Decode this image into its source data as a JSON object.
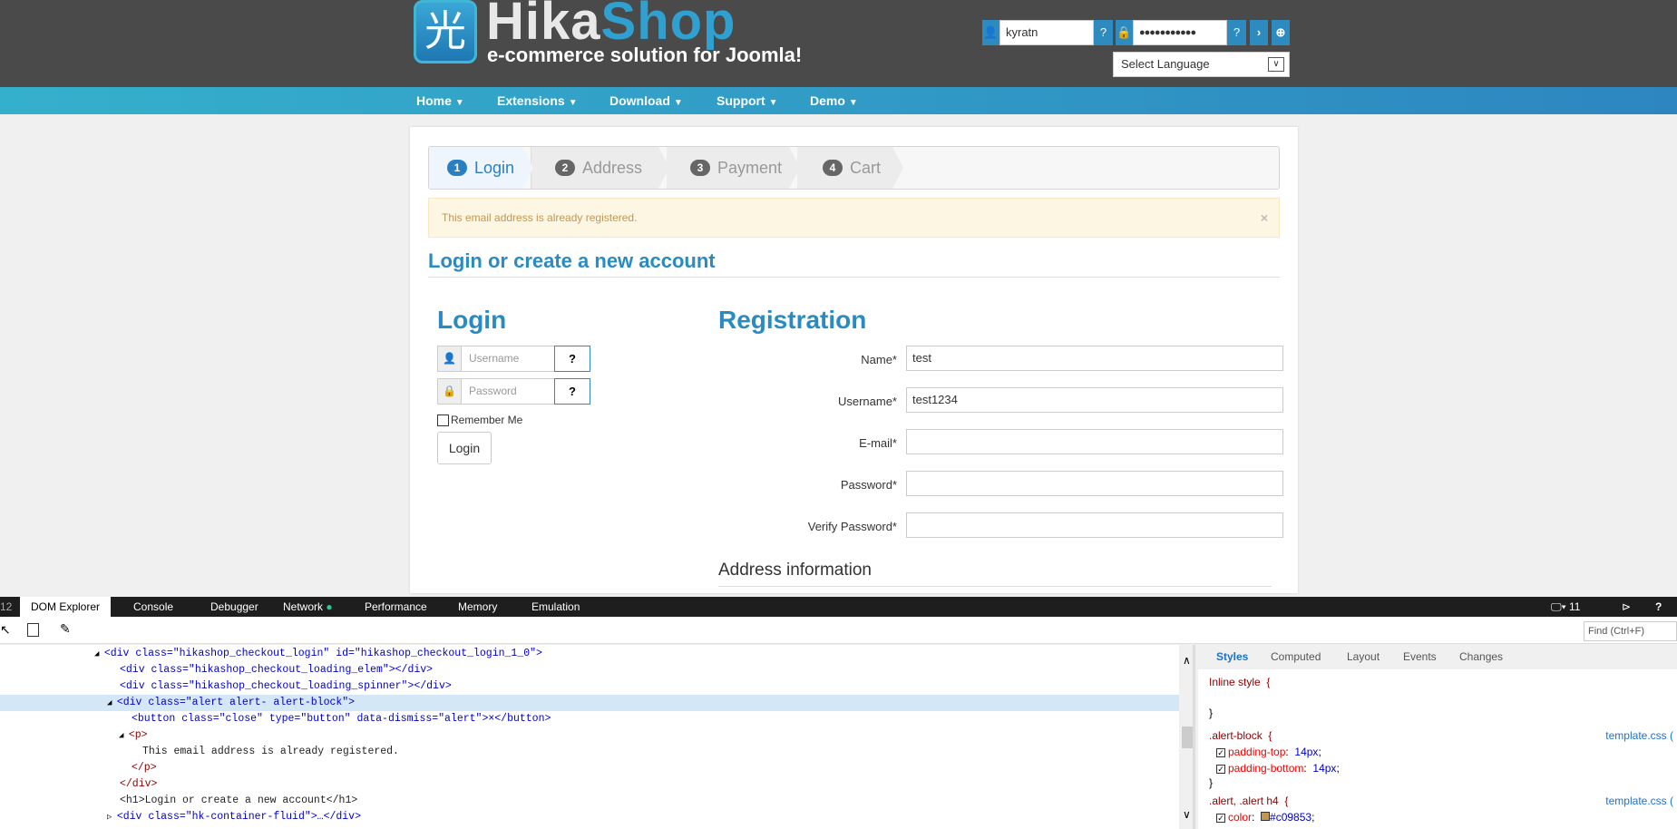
{
  "header": {
    "logo_glyph": "光",
    "logo_hika": "Hika",
    "logo_shop": "Shop",
    "tagline": "e-commerce solution for Joomla!",
    "username_value": "kyratn",
    "password_value": "●●●●●●●●●●●",
    "language_select": "Select Language"
  },
  "nav": [
    "Home",
    "Extensions",
    "Download",
    "Support",
    "Demo"
  ],
  "steps": [
    {
      "num": "1",
      "label": "Login"
    },
    {
      "num": "2",
      "label": "Address"
    },
    {
      "num": "3",
      "label": "Payment"
    },
    {
      "num": "4",
      "label": "Cart"
    }
  ],
  "alert": {
    "message": "This email address is already registered.",
    "close": "×"
  },
  "page_title": "Login or create a new account",
  "login": {
    "title": "Login",
    "username_placeholder": "Username",
    "password_placeholder": "Password",
    "remember_label": "Remember Me",
    "button": "Login"
  },
  "registration": {
    "title": "Registration",
    "fields": [
      {
        "label": "Name*",
        "value": "test"
      },
      {
        "label": "Username*",
        "value": "test1234"
      },
      {
        "label": "E-mail*",
        "value": ""
      },
      {
        "label": "Password*",
        "value": ""
      },
      {
        "label": "Verify Password*",
        "value": ""
      }
    ],
    "address_heading": "Address information"
  },
  "devtools": {
    "f12": "12",
    "tabs": [
      "DOM Explorer",
      "Console",
      "Debugger",
      "Network",
      "Performance",
      "Memory",
      "Emulation"
    ],
    "doc_mode": "11",
    "help": "?",
    "find_placeholder": "Find (Ctrl+F)",
    "dom_lines": [
      "<div class=\"hikashop_checkout_login\" id=\"hikashop_checkout_login_1_0\">",
      "<div class=\"hikashop_checkout_loading_elem\"></div>",
      "<div class=\"hikashop_checkout_loading_spinner\"></div>",
      "<div class=\"alert alert- alert-block\">",
      "<button class=\"close\" type=\"button\" data-dismiss=\"alert\">×</button>",
      "<p>",
      "This email address is already registered.",
      "</p>",
      "</div>",
      "<h1>Login or create a new account</h1>",
      "<div class=\"hk-container-fluid\">…</div>"
    ],
    "style_tabs": [
      "Styles",
      "Computed",
      "Layout",
      "Events",
      "Changes"
    ],
    "styles": {
      "inline": "Inline style  {",
      "close": "}",
      "rule1": ".alert-block  {",
      "p1": "padding-top",
      "v1": "14px",
      "p2": "padding-bottom",
      "v2": "14px",
      "rule2": ".alert, .alert h4  {",
      "p3": "color",
      "v3": "#c09853",
      "source": "template.css ("
    }
  },
  "colors": {
    "accent": "#2a8bc3",
    "alert_text": "#c09853",
    "alert_bg": "#fcf6e3"
  }
}
